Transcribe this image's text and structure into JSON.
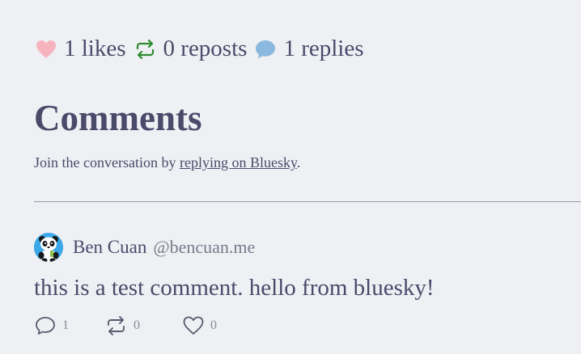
{
  "post_stats": {
    "likes_label": "1 likes",
    "reposts_label": "0 reposts",
    "replies_label": "1 replies"
  },
  "comments_section": {
    "title": "Comments",
    "join_prefix": "Join the conversation by ",
    "join_link": "replying on Bluesky",
    "join_suffix": "."
  },
  "comment": {
    "author_name": "Ben Cuan",
    "author_handle": "@bencuan.me",
    "text": "this is a test comment. hello from bluesky!",
    "reply_count": "1",
    "repost_count": "0",
    "like_count": "0"
  },
  "icons": {
    "heart_color": "#f7b4bf",
    "repost_color": "#2e8b2e",
    "reply_color": "#8ab8de",
    "avatar_bg": "#3ba8e8",
    "names": [
      "heart-icon",
      "repost-icon",
      "speech-bubble-icon",
      "reply-icon",
      "like-icon"
    ]
  }
}
